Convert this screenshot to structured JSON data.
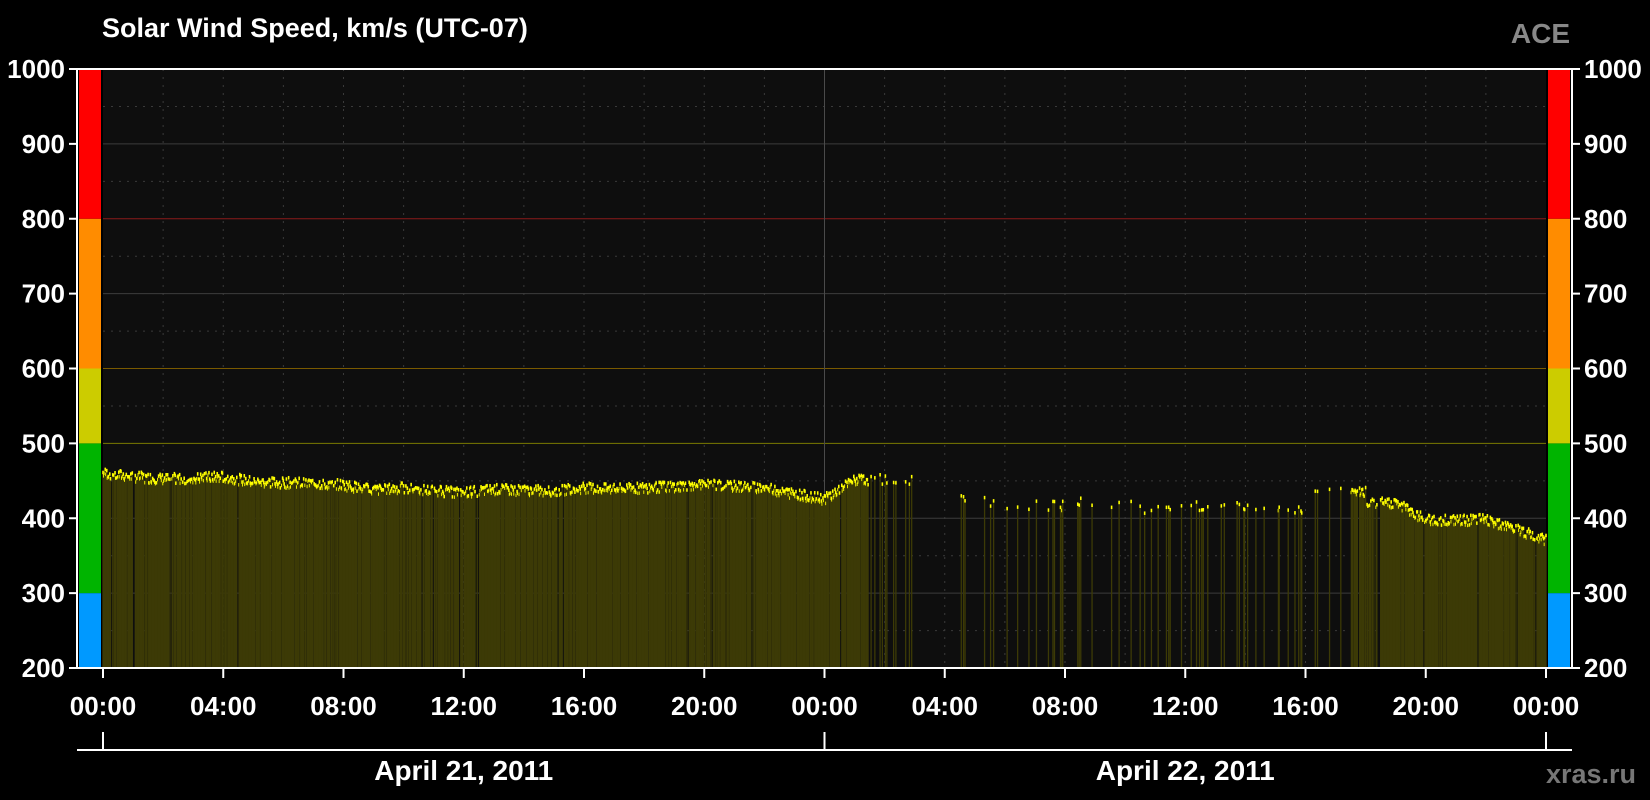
{
  "chart_data": {
    "type": "area",
    "title": "Solar Wind Speed, km/s (UTC-07)",
    "source_label": "ACE",
    "credit": "xras.ru",
    "ylim": [
      200,
      1000
    ],
    "y_ticks": [
      200,
      300,
      400,
      500,
      600,
      700,
      800,
      900,
      1000
    ],
    "y_tick_labels": [
      "200",
      "300",
      "400",
      "500",
      "600",
      "700",
      "800",
      "900",
      "1000"
    ],
    "xlim_hours": [
      0,
      48
    ],
    "x_ticks_hours": [
      0,
      4,
      8,
      12,
      16,
      20,
      24,
      28,
      32,
      36,
      40,
      44,
      48
    ],
    "x_tick_labels": [
      "00:00",
      "04:00",
      "08:00",
      "12:00",
      "16:00",
      "20:00",
      "00:00",
      "04:00",
      "08:00",
      "12:00",
      "16:00",
      "20:00",
      "00:00"
    ],
    "date_labels": [
      "April 21, 2011",
      "April 22, 2011"
    ],
    "color_scale": [
      {
        "from": 200,
        "to": 300,
        "color": "#0099ff"
      },
      {
        "from": 300,
        "to": 500,
        "color": "#00b400"
      },
      {
        "from": 500,
        "to": 600,
        "color": "#cccc00"
      },
      {
        "from": 600,
        "to": 800,
        "color": "#ff8c00"
      },
      {
        "from": 800,
        "to": 1000,
        "color": "#ff0000"
      }
    ],
    "threshold_lines": [
      {
        "value": 500,
        "color": "#7a7a00"
      },
      {
        "value": 600,
        "color": "#7a5a00"
      },
      {
        "value": 800,
        "color": "#8a1a1a"
      }
    ],
    "series": [
      {
        "color": "#ffff00",
        "fill": "#3c3a06",
        "hours": [
          0,
          1,
          2,
          3,
          4,
          5,
          6,
          7,
          8,
          9,
          10,
          11,
          12,
          13,
          14,
          15,
          16,
          17,
          18,
          19,
          20,
          21,
          22,
          23,
          24,
          25,
          26,
          27,
          28,
          29,
          30,
          31,
          32,
          33,
          34,
          35,
          36,
          37,
          38,
          39,
          40,
          41,
          42,
          43,
          44,
          45,
          46,
          47,
          48
        ],
        "values": [
          460,
          455,
          452,
          453,
          455,
          448,
          447,
          446,
          444,
          437,
          440,
          436,
          434,
          438,
          437,
          436,
          440,
          438,
          440,
          442,
          445,
          442,
          440,
          432,
          425,
          450,
          452,
          null,
          null,
          423,
          418,
          416,
          null,
          420,
          418,
          410,
          null,
          417,
          null,
          412,
          null,
          435,
          null,
          420,
          398,
          396,
          398,
          385,
          370
        ],
        "dense_until_hour": 25.5,
        "sparse_from_hour": 25.5,
        "dense_from_hour": 41.5
      }
    ]
  }
}
